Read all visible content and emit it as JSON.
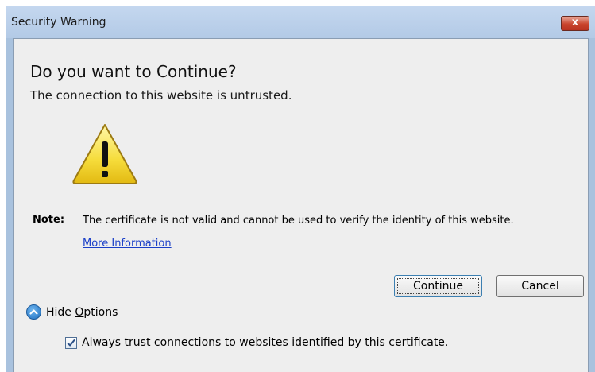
{
  "window": {
    "title": "Security Warning",
    "close_label": "x"
  },
  "dialog": {
    "heading": "Do you want to Continue?",
    "subheading": "The connection to this website is untrusted.",
    "note_label": "Note:",
    "note_text": "The certificate is not valid and cannot be used to verify the identity of this website.",
    "more_info_link": "More Information",
    "icon": "warning-icon"
  },
  "buttons": {
    "continue": "Continue",
    "cancel": "Cancel"
  },
  "options": {
    "toggle_label_prefix": "Hide ",
    "toggle_label_accel": "O",
    "toggle_label_rest": "ptions",
    "checkbox_checked": true,
    "checkbox_label_accel": "A",
    "checkbox_label_rest": "lways trust connections to websites identified by this certificate."
  }
}
